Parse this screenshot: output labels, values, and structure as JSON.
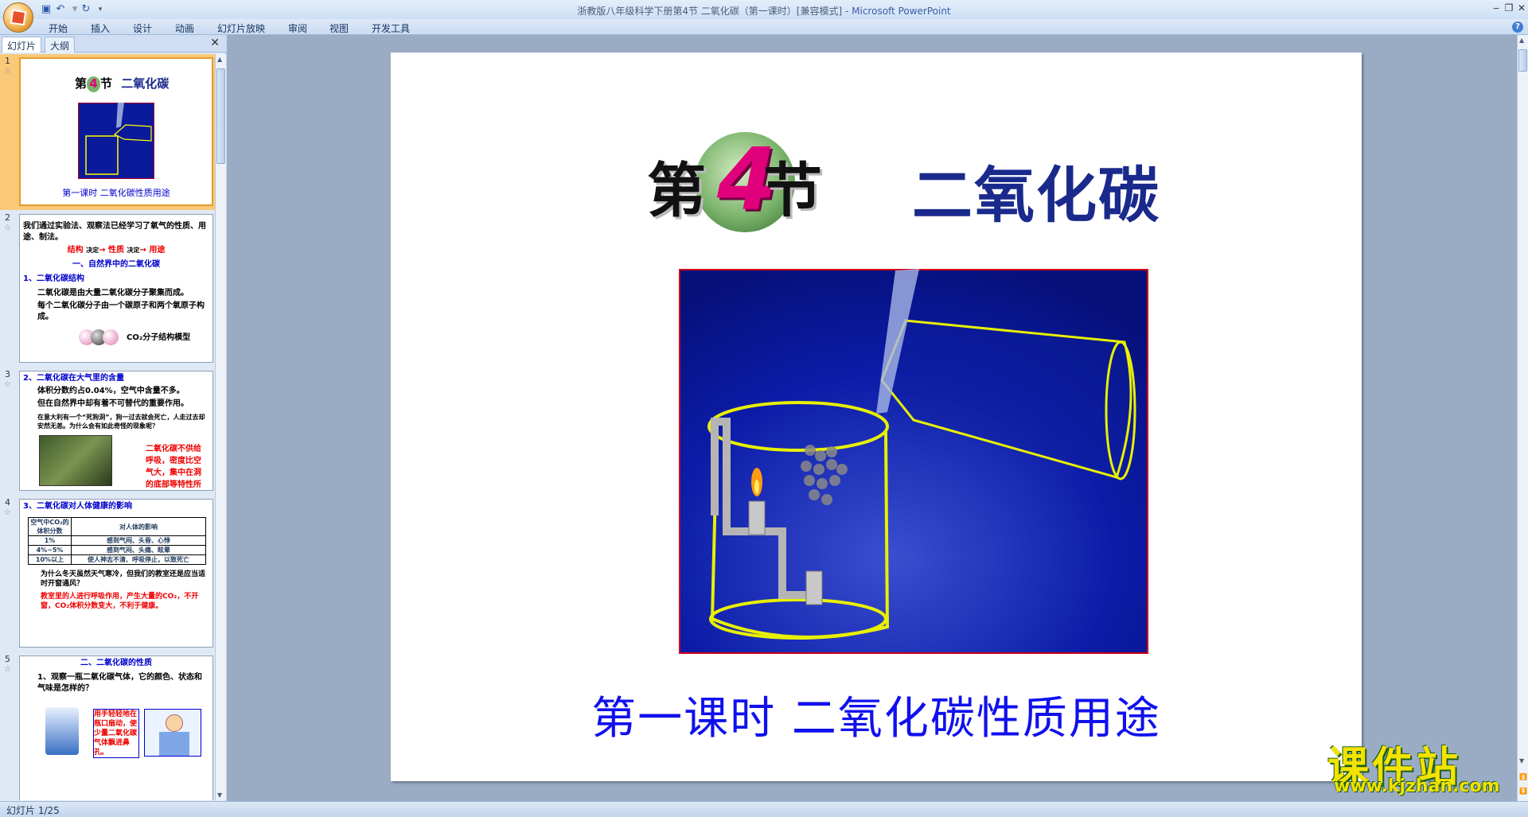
{
  "window": {
    "title": "浙教版八年级科学下册第4节 二氧化碳（第一课时）[兼容模式]",
    "app_name": "Microsoft PowerPoint",
    "separator": " - "
  },
  "ribbon": {
    "tabs": [
      "开始",
      "插入",
      "设计",
      "动画",
      "幻灯片放映",
      "审阅",
      "视图",
      "开发工具"
    ]
  },
  "panel": {
    "tabs": [
      "幻灯片",
      "大纲"
    ],
    "close": "✕"
  },
  "thumbs": {
    "s1": {
      "num": "1",
      "heading_left": "第",
      "heading_num": "4",
      "heading_right": "节",
      "heading_title": "二氧化碳",
      "caption": "第一课时   二氧化碳性质用途"
    },
    "s2": {
      "num": "2",
      "intro": "我们通过实验法、观察法已经学习了氧气的性质、用途、制法。",
      "chain": [
        "结构",
        "性质",
        "用途"
      ],
      "chain_arrow": "决定",
      "section": "一、自然界中的二氧化碳",
      "sub": "1、二氧化碳结构",
      "p1": "二氧化碳是由大量二氧化碳分子聚集而成。",
      "p2": "每个二氧化碳分子由一个碳原子和两个氧原子构成。",
      "model": "CO₂分子结构模型"
    },
    "s3": {
      "num": "3",
      "head": "2、二氧化碳在大气里的含量",
      "p1": "体积分数约占0.04%，空气中含量不多。",
      "p2": "但在自然界中却有着不可替代的重要作用。",
      "q": "在意大利有一个“死狗洞”，狗一过去就会死亡，人走过去却安然无恙。为什么会有如此奇怪的现象呢？",
      "a": "二氧化碳不供给呼吸，密度比空气大，集中在洞的底部等特性所造成"
    },
    "s4": {
      "num": "4",
      "head": "3、二氧化碳对人体健康的影响",
      "col1": "空气中CO₂的体积分数",
      "col2": "对人体的影响",
      "rows": [
        [
          "1%",
          "感到气闷、头昏、心悸"
        ],
        [
          "4%~5%",
          "感到气闷、头痛、眩晕"
        ],
        [
          "10%以上",
          "使人神志不清、呼吸停止，以致死亡"
        ]
      ],
      "q": "为什么冬天虽然天气寒冷，但我们的教室还是应当适时开窗通风？",
      "a": "教室里的人进行呼吸作用，产生大量的CO₂，不开窗，CO₂体积分数变大，不利于健康。"
    },
    "s5": {
      "num": "5",
      "head": "二、二氧化碳的性质",
      "q": "1、观察一瓶二氧化碳气体，它的颜色、状态和气味是怎样的？",
      "tip": "用手轻轻地在瓶口扇动，使少量二氧化碳气体飘进鼻孔。"
    }
  },
  "slide": {
    "heading_left": "第",
    "heading_num": "4",
    "heading_right": "节",
    "heading_title": "二氧化碳",
    "subtitle": "第一课时   二氧化碳性质用途"
  },
  "status": {
    "text": "幻灯片 1/25"
  },
  "watermark": {
    "cn": "课件站",
    "url": "www.kjzhan.com"
  },
  "colors": {
    "title_blue": "#1a2a8c",
    "subtitle_blue": "#1010ee",
    "slide_image_bg": "#0b1a9a",
    "watermark_yellow": "#f4e200"
  }
}
